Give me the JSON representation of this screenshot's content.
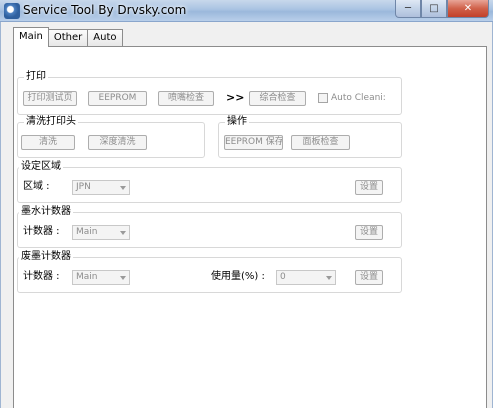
{
  "window": {
    "title": "Service Tool By Drvsky.com",
    "minimize": "─",
    "maximize": "□",
    "close": "✕"
  },
  "tabs": [
    {
      "label": "Main",
      "active": true
    },
    {
      "label": "Other",
      "active": false
    },
    {
      "label": "Auto",
      "active": false
    }
  ],
  "print_group": {
    "title": "打印",
    "print_test_page": "打印测试页",
    "eeprom": "EEPROM",
    "nozzle_check": "喷嘴检查",
    "arrow": ">>",
    "comprehensive_check": "综合检查",
    "auto_clean_label": "Auto Cleani:"
  },
  "clean_group": {
    "title": "清洗打印头",
    "clean": "清洗",
    "deep_clean": "深度清洗"
  },
  "operation_group": {
    "title": "操作",
    "eeprom_save": "EEPROM 保存",
    "panel_check": "面板检查"
  },
  "region_group": {
    "title": "设定区域",
    "region_label": "区域 :",
    "region_value": "JPN",
    "set": "设置"
  },
  "ink_counter_group": {
    "title": "墨水计数器",
    "counter_label": "计数器 :",
    "counter_value": "Main",
    "set": "设置"
  },
  "waste_counter_group": {
    "title": "废墨计数器",
    "counter_label": "计数器 :",
    "counter_value": "Main",
    "usage_label": "使用量(%) :",
    "usage_value": "0",
    "set": "设置"
  }
}
